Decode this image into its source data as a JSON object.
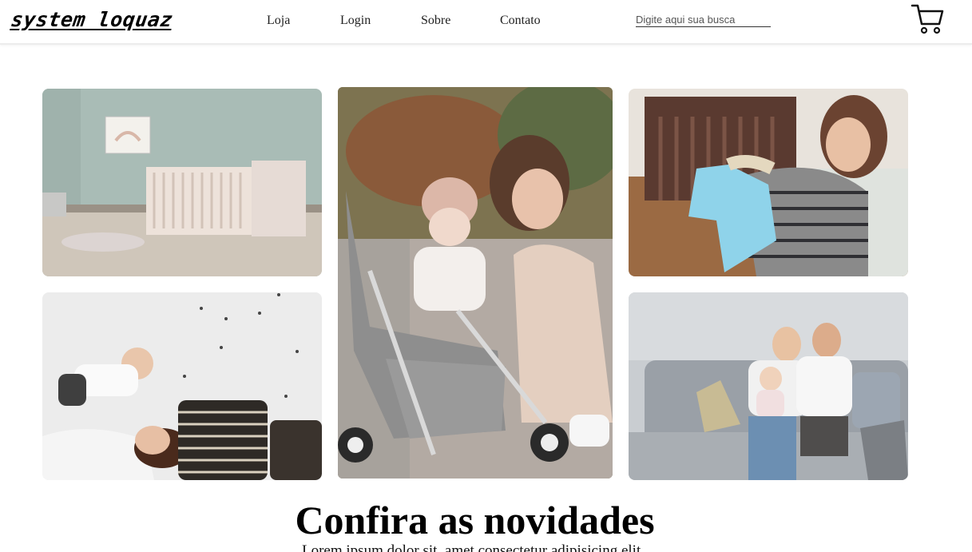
{
  "header": {
    "logo": "system loquaz",
    "nav": [
      {
        "label": "Loja"
      },
      {
        "label": "Login"
      },
      {
        "label": "Sobre"
      },
      {
        "label": "Contato"
      }
    ],
    "search_placeholder": "Digite aqui sua busca",
    "cart_icon": "shopping-cart-icon"
  },
  "gallery": [
    {
      "name": "nursery-crib-photo",
      "palette": "#a9bcb6"
    },
    {
      "name": "mother-baby-stroller-photo",
      "palette": "#6f6a4e"
    },
    {
      "name": "pregnant-woman-onesie-photo",
      "palette": "#e8e3dc"
    },
    {
      "name": "mother-lifting-baby-photo",
      "palette": "#ececec"
    },
    {
      "name": "family-on-sofa-photo",
      "palette": "#c9cdd1"
    }
  ],
  "section": {
    "title": "Confira as novidades",
    "subtitle": "Lorem ipsum dolor sit, amet consectetur adipisicing elit."
  }
}
